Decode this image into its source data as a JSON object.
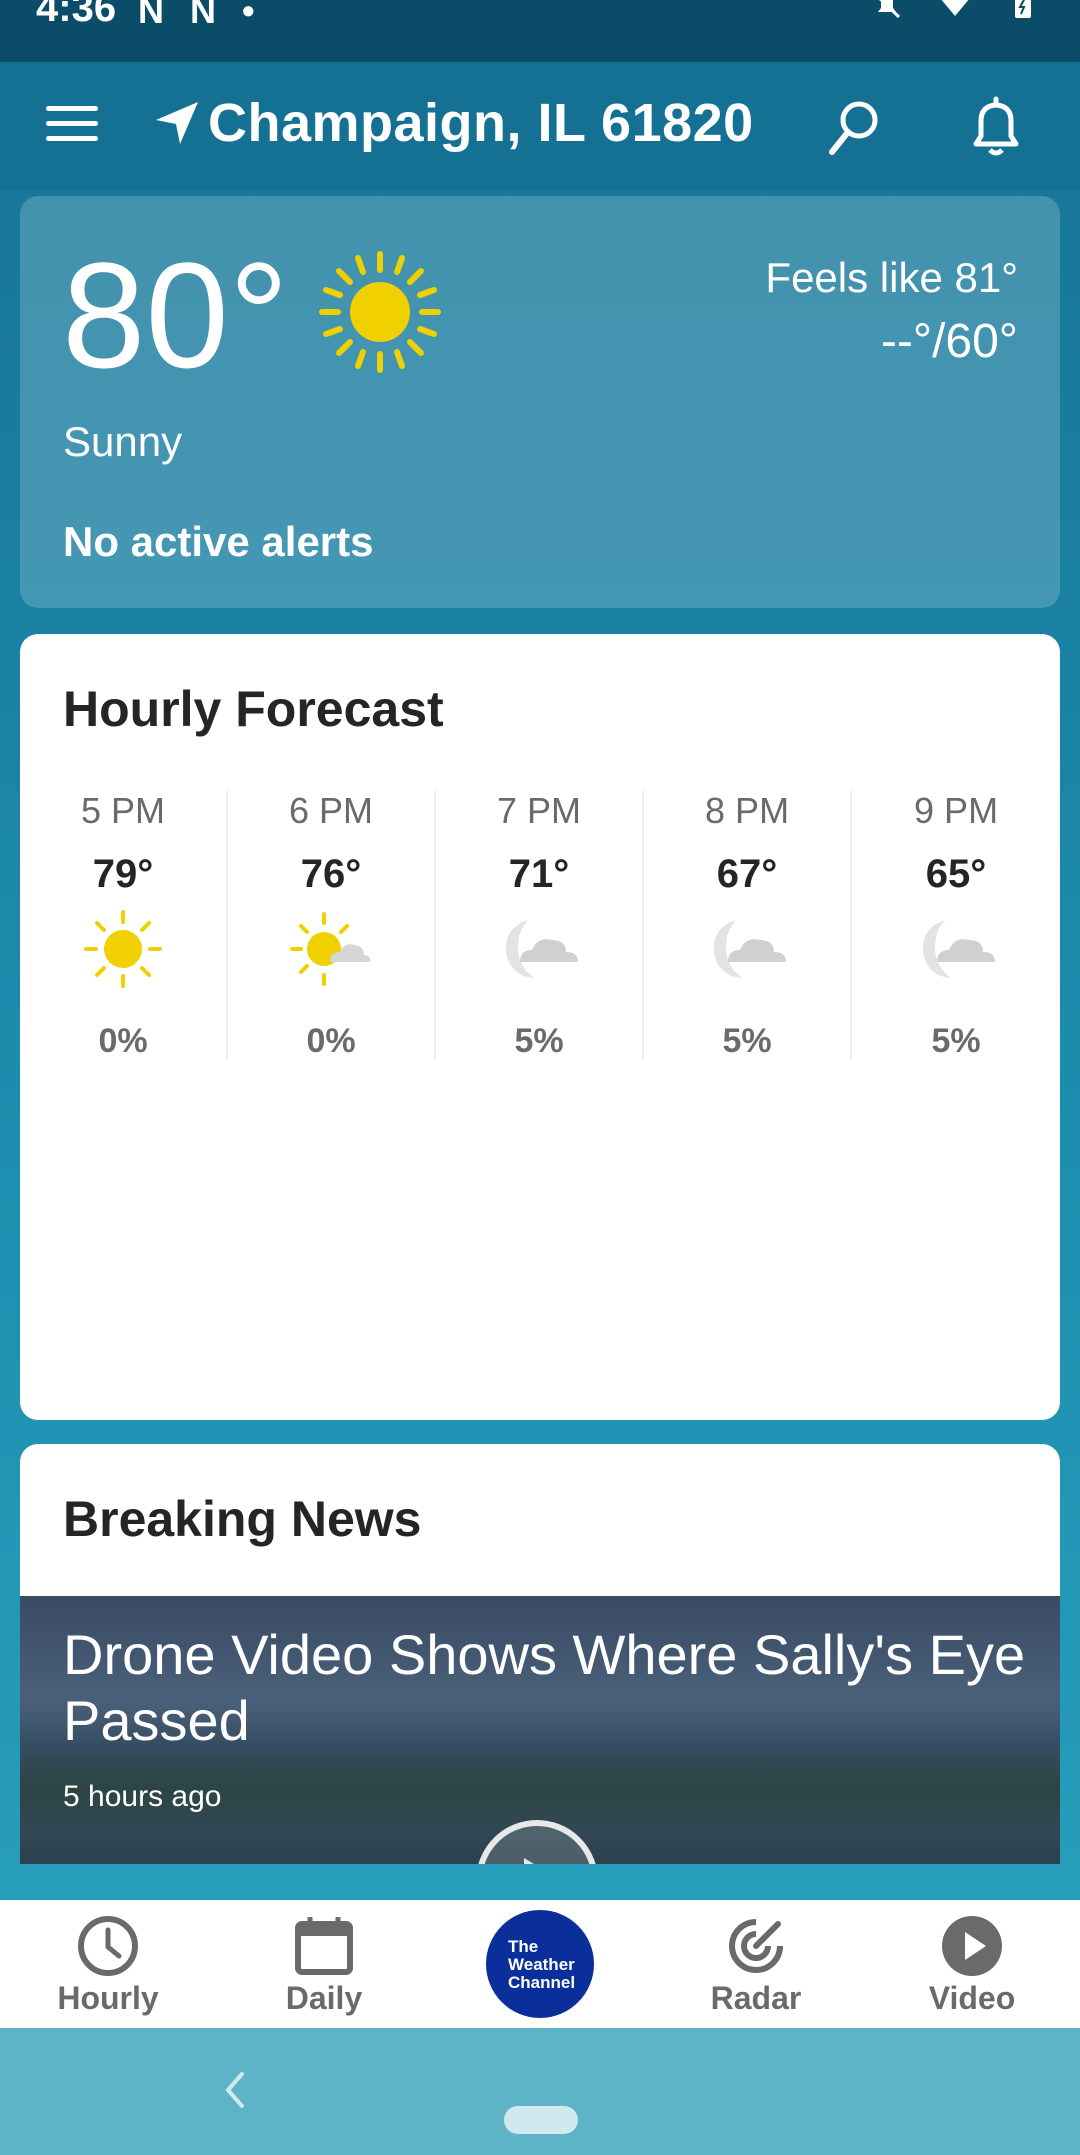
{
  "status_bar": {
    "time": "4:36",
    "left_icons": "N N •",
    "right_icons": [
      "silent-icon",
      "wifi-icon",
      "battery-icon"
    ]
  },
  "header": {
    "location": "Champaign, IL 61820",
    "icons": [
      "menu-icon",
      "location-arrow-icon",
      "search-icon",
      "bell-icon"
    ]
  },
  "current": {
    "temp": "80°",
    "condition": "Sunny",
    "feels_like": "Feels like 81°",
    "hi_lo": "--°/60°",
    "alerts": "No active alerts",
    "icon": "sun-icon"
  },
  "hourly": {
    "title": "Hourly Forecast",
    "items": [
      {
        "time": "5 PM",
        "temp": "79°",
        "precip": "0%",
        "icon": "sun-icon"
      },
      {
        "time": "6 PM",
        "temp": "76°",
        "precip": "0%",
        "icon": "sun-cloud-icon"
      },
      {
        "time": "7 PM",
        "temp": "71°",
        "precip": "5%",
        "icon": "moon-cloud-icon"
      },
      {
        "time": "8 PM",
        "temp": "67°",
        "precip": "5%",
        "icon": "moon-cloud-icon"
      },
      {
        "time": "9 PM",
        "temp": "65°",
        "precip": "5%",
        "icon": "moon-cloud-icon"
      }
    ]
  },
  "news": {
    "title": "Breaking News",
    "headline": "Drone Video Shows Where Sally's Eye Passed",
    "age": "5 hours ago"
  },
  "bottom_nav": {
    "items": [
      {
        "label": "Hourly",
        "icon": "clock-icon"
      },
      {
        "label": "Daily",
        "icon": "calendar-icon"
      },
      {
        "label": "",
        "icon": "weather-channel-logo"
      },
      {
        "label": "Radar",
        "icon": "radar-icon"
      },
      {
        "label": "Video",
        "icon": "play-icon"
      }
    ],
    "logo_text": [
      "The",
      "Weather",
      "Channel"
    ]
  },
  "colors": {
    "header_bg": "#157193",
    "sun_yellow": "#f0d000",
    "logo_blue": "#0b2f9a",
    "nav_gray": "#6a6a6a"
  }
}
